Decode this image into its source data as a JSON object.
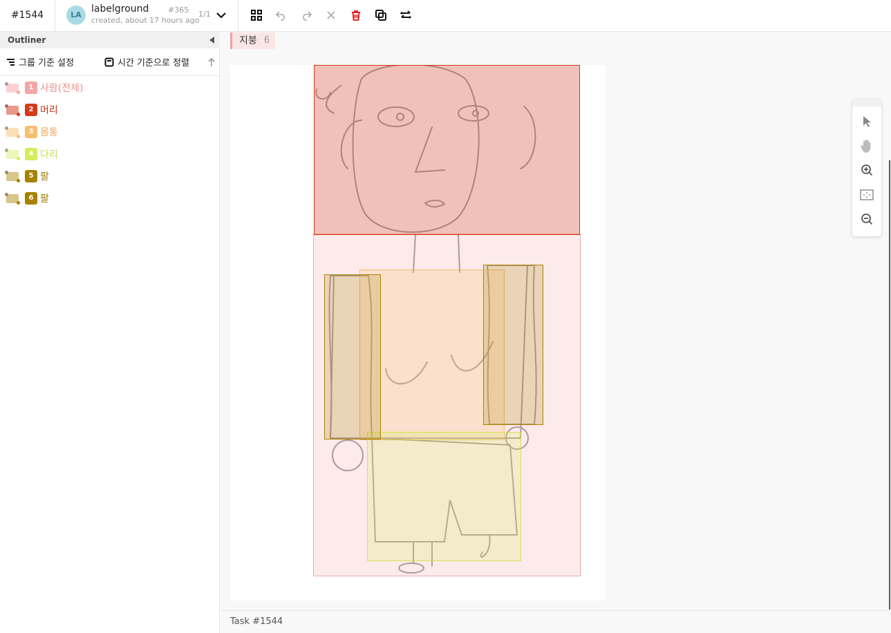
{
  "header": {
    "task_id": "#1544",
    "avatar_initials": "LA",
    "project_name": "labelground",
    "project_meta": "created, about 17 hours ago",
    "project_number": "#365",
    "pager": "1/1"
  },
  "toolbar": {
    "buttons": [
      "grid-icon",
      "undo-icon",
      "redo-icon",
      "close-icon",
      "delete-icon",
      "copy-icon",
      "swap-icon"
    ]
  },
  "sidebar": {
    "title": "Outliner",
    "group_label": "그룹 기준 설정",
    "sort_label": "시간 기준으로 정렬",
    "classes": [
      {
        "num": "1",
        "label": "사람(전체)",
        "color": "#f4a5a5"
      },
      {
        "num": "2",
        "label": "머리",
        "color": "#d53a1a"
      },
      {
        "num": "3",
        "label": "몸통",
        "color": "#f7bf74"
      },
      {
        "num": "4",
        "label": "다리",
        "color": "#d4ed5c"
      },
      {
        "num": "5",
        "label": "팔",
        "color": "#a88300"
      },
      {
        "num": "6",
        "label": "팔",
        "color": "#a88300"
      }
    ]
  },
  "canvas": {
    "chip_label": "지붕",
    "chip_count": "6"
  },
  "tools": [
    "pointer-icon",
    "hand-icon",
    "zoom-in-icon",
    "fit-screen-icon",
    "zoom-out-icon"
  ],
  "status": {
    "text": "Task #1544"
  }
}
